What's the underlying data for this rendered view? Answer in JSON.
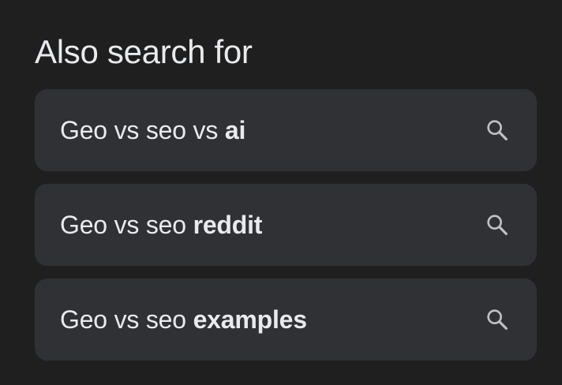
{
  "heading": "Also search for",
  "suggestions": [
    {
      "prefix": "Geo vs seo vs ",
      "bold": "ai",
      "icon": "search-icon"
    },
    {
      "prefix": "Geo vs seo ",
      "bold": "reddit",
      "icon": "search-icon"
    },
    {
      "prefix": "Geo vs seo ",
      "bold": "examples",
      "icon": "search-icon"
    }
  ],
  "colors": {
    "background": "#1f1f1f",
    "chip_background": "#303134",
    "text": "#e8eaed",
    "icon": "#bdc1c6"
  }
}
